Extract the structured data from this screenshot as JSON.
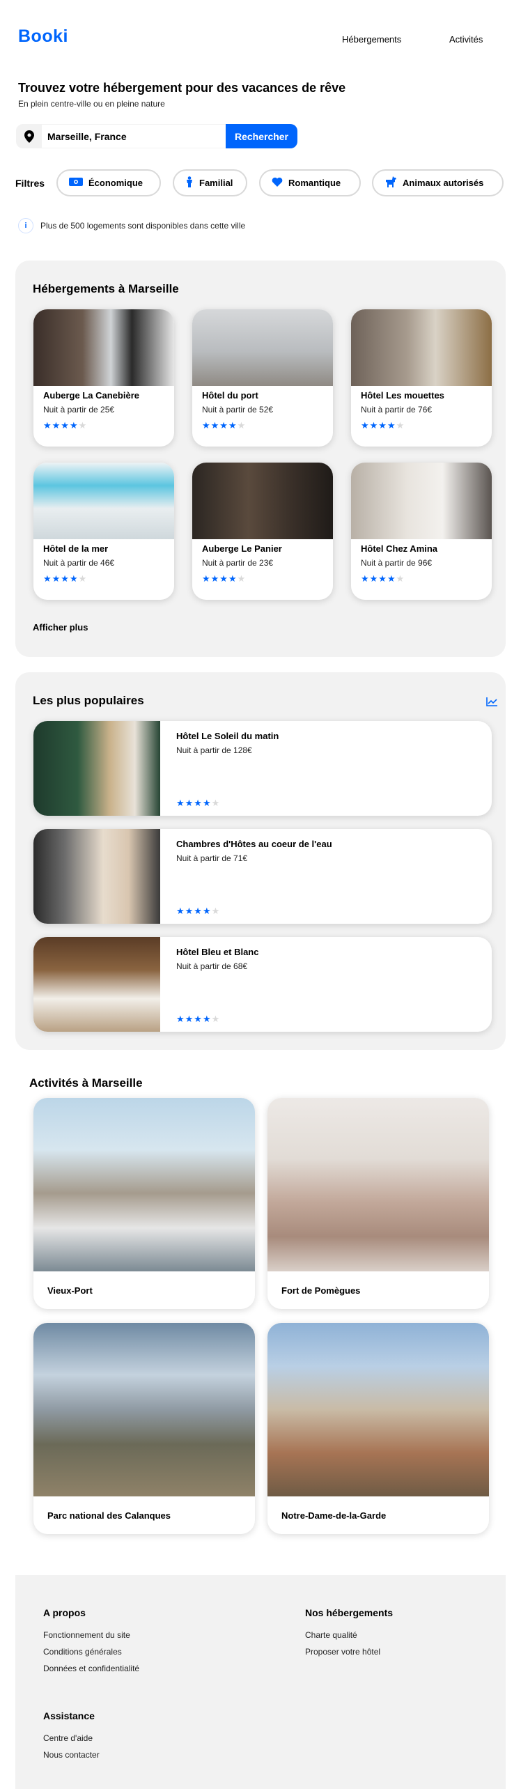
{
  "header": {
    "logo": "Booki",
    "nav": [
      {
        "label": "Hébergements"
      },
      {
        "label": "Activités"
      }
    ]
  },
  "hero": {
    "title": "Trouvez votre hébergement pour des vacances de rêve",
    "subtitle": "En plein centre-ville ou en pleine nature"
  },
  "search": {
    "value": "Marseille, France",
    "button": "Rechercher"
  },
  "filters": {
    "label": "Filtres",
    "items": [
      {
        "label": "Économique",
        "icon": "money-icon"
      },
      {
        "label": "Familial",
        "icon": "child-icon"
      },
      {
        "label": "Romantique",
        "icon": "heart-icon"
      },
      {
        "label": "Animaux autorisés",
        "icon": "dog-icon"
      }
    ]
  },
  "info": {
    "text": "Plus de 500 logements sont disponibles dans cette ville"
  },
  "accommodations": {
    "title": "Hébergements à Marseille",
    "items": [
      {
        "name": "Auberge La Canebière",
        "price": "Nuit à partir de 25€",
        "rating": 4
      },
      {
        "name": "Hôtel du port",
        "price": "Nuit à partir de 52€",
        "rating": 4
      },
      {
        "name": "Hôtel Les mouettes",
        "price": "Nuit à partir de 76€",
        "rating": 4
      },
      {
        "name": "Hôtel de la mer",
        "price": "Nuit à partir de 46€",
        "rating": 4
      },
      {
        "name": "Auberge Le Panier",
        "price": "Nuit à partir de 23€",
        "rating": 4
      },
      {
        "name": "Hôtel Chez Amina",
        "price": "Nuit à partir de 96€",
        "rating": 4
      }
    ],
    "more": "Afficher plus"
  },
  "popular": {
    "title": "Les plus populaires",
    "items": [
      {
        "name": "Hôtel Le Soleil du matin",
        "price": "Nuit à partir de 128€",
        "rating": 4
      },
      {
        "name": "Chambres d'Hôtes au coeur de l'eau",
        "price": "Nuit à partir de 71€",
        "rating": 4
      },
      {
        "name": "Hôtel Bleu et Blanc",
        "price": "Nuit à partir de 68€",
        "rating": 4
      }
    ]
  },
  "activities": {
    "title": "Activités à Marseille",
    "items": [
      {
        "name": "Vieux-Port"
      },
      {
        "name": "Fort de Pomègues"
      },
      {
        "name": "Parc national des Calanques"
      },
      {
        "name": "Notre-Dame-de-la-Garde"
      }
    ]
  },
  "footer": {
    "columns": [
      {
        "title": "A propos",
        "links": [
          "Fonctionnement du site",
          "Conditions générales",
          "Données et confidentialité"
        ]
      },
      {
        "title": "Nos hébergements",
        "links": [
          "Charte qualité",
          "Proposer votre hôtel"
        ]
      },
      {
        "title": "Assistance",
        "links": [
          "Centre d'aide",
          "Nous contacter"
        ]
      }
    ]
  },
  "colors": {
    "accent": "#0065fc",
    "panel": "#f2f2f2",
    "star_off": "#d9d9d9"
  }
}
